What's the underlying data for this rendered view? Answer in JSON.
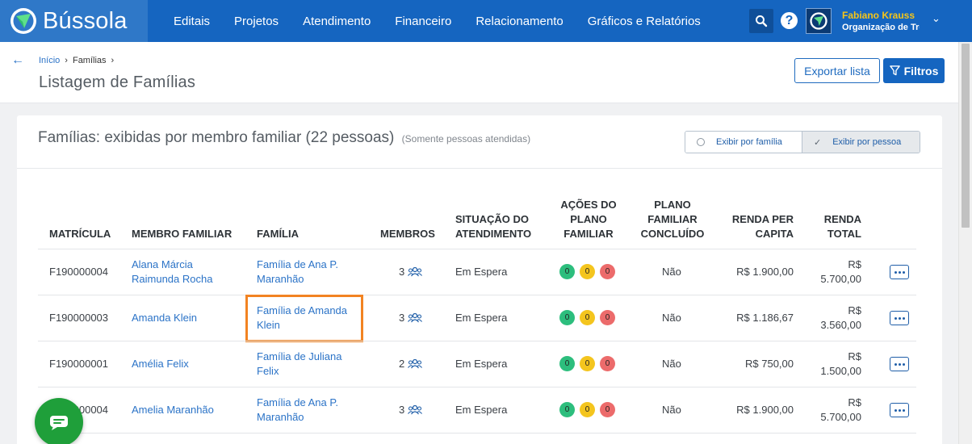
{
  "app": {
    "name": "Bússola"
  },
  "nav": [
    "Editais",
    "Projetos",
    "Atendimento",
    "Financeiro",
    "Relacionamento",
    "Gráficos e Relatórios"
  ],
  "user": {
    "name": "Fabiano Krauss",
    "org": "Organização de Tre"
  },
  "breadcrumb": {
    "home": "Início",
    "current": "Famílias"
  },
  "page": {
    "title": "Listagem de Famílias"
  },
  "actions": {
    "export": "Exportar lista",
    "filters": "Filtros"
  },
  "card": {
    "title": "Famílias: exibidas por membro familiar (22 pessoas)",
    "subtitle": "(Somente pessoas atendidas)",
    "toggle_family": "Exibir por família",
    "toggle_person": "Exibir por pessoa"
  },
  "columns": {
    "matricula": "MATRÍCULA",
    "membro": "MEMBRO FAMILIAR",
    "familia": "FAMÍLIA",
    "membros": "MEMBROS",
    "situacao_1": "SITUAÇÃO DO",
    "situacao_2": "ATENDIMENTO",
    "acoes_1": "AÇÕES DO",
    "acoes_2": "PLANO",
    "acoes_3": "FAMILIAR",
    "plano_1": "PLANO",
    "plano_2": "FAMILIAR",
    "plano_3": "CONCLUÍDO",
    "renda_pc_1": "RENDA PER",
    "renda_pc_2": "CAPITA",
    "renda_t_1": "RENDA",
    "renda_t_2": "TOTAL"
  },
  "rows": [
    {
      "matricula": "F190000004",
      "membro_1": "Alana Márcia",
      "membro_2": "Raimunda Rocha",
      "familia_1": "Família de Ana P.",
      "familia_2": "Maranhão",
      "membros": "3",
      "situacao": "Em Espera",
      "acoes": [
        "0",
        "0",
        "0"
      ],
      "concluido": "Não",
      "renda_pc": "R$ 1.900,00",
      "renda_t_1": "R$",
      "renda_t_2": "5.700,00"
    },
    {
      "matricula": "F190000003",
      "membro_1": "Amanda Klein",
      "membro_2": "",
      "familia_1": "Família de Amanda",
      "familia_2": "Klein",
      "membros": "3",
      "situacao": "Em Espera",
      "acoes": [
        "0",
        "0",
        "0"
      ],
      "concluido": "Não",
      "renda_pc": "R$ 1.186,67",
      "renda_t_1": "R$",
      "renda_t_2": "3.560,00"
    },
    {
      "matricula": "F190000001",
      "membro_1": "Amélia Felix",
      "membro_2": "",
      "familia_1": "Família de Juliana",
      "familia_2": "Felix",
      "membros": "2",
      "situacao": "Em Espera",
      "acoes": [
        "0",
        "0",
        "0"
      ],
      "concluido": "Não",
      "renda_pc": "R$ 750,00",
      "renda_t_1": "R$",
      "renda_t_2": "1.500,00"
    },
    {
      "matricula": "F190000004",
      "membro_1": "Amelia Maranhão",
      "membro_2": "",
      "familia_1": "Família de Ana P.",
      "familia_2": "Maranhão",
      "membros": "3",
      "situacao": "Em Espera",
      "acoes": [
        "0",
        "0",
        "0"
      ],
      "concluido": "Não",
      "renda_pc": "R$ 1.900,00",
      "renda_t_1": "R$",
      "renda_t_2": "5.700,00"
    }
  ],
  "icons": {
    "logo": "compass-logo-icon",
    "search": "search-icon",
    "help": "help-icon",
    "members": "people-icon",
    "chat": "chat-icon"
  },
  "colors": {
    "nav_bg": "#1565c0",
    "brand_bg": "#2f78c8",
    "link": "#2b73c7",
    "user_name": "#f5c518",
    "dot_green": "#2dbe7d",
    "dot_yellow": "#f4c51e",
    "dot_red": "#ec6b6b",
    "highlight": "#f28322",
    "chat_fab": "#1f9f3a"
  }
}
